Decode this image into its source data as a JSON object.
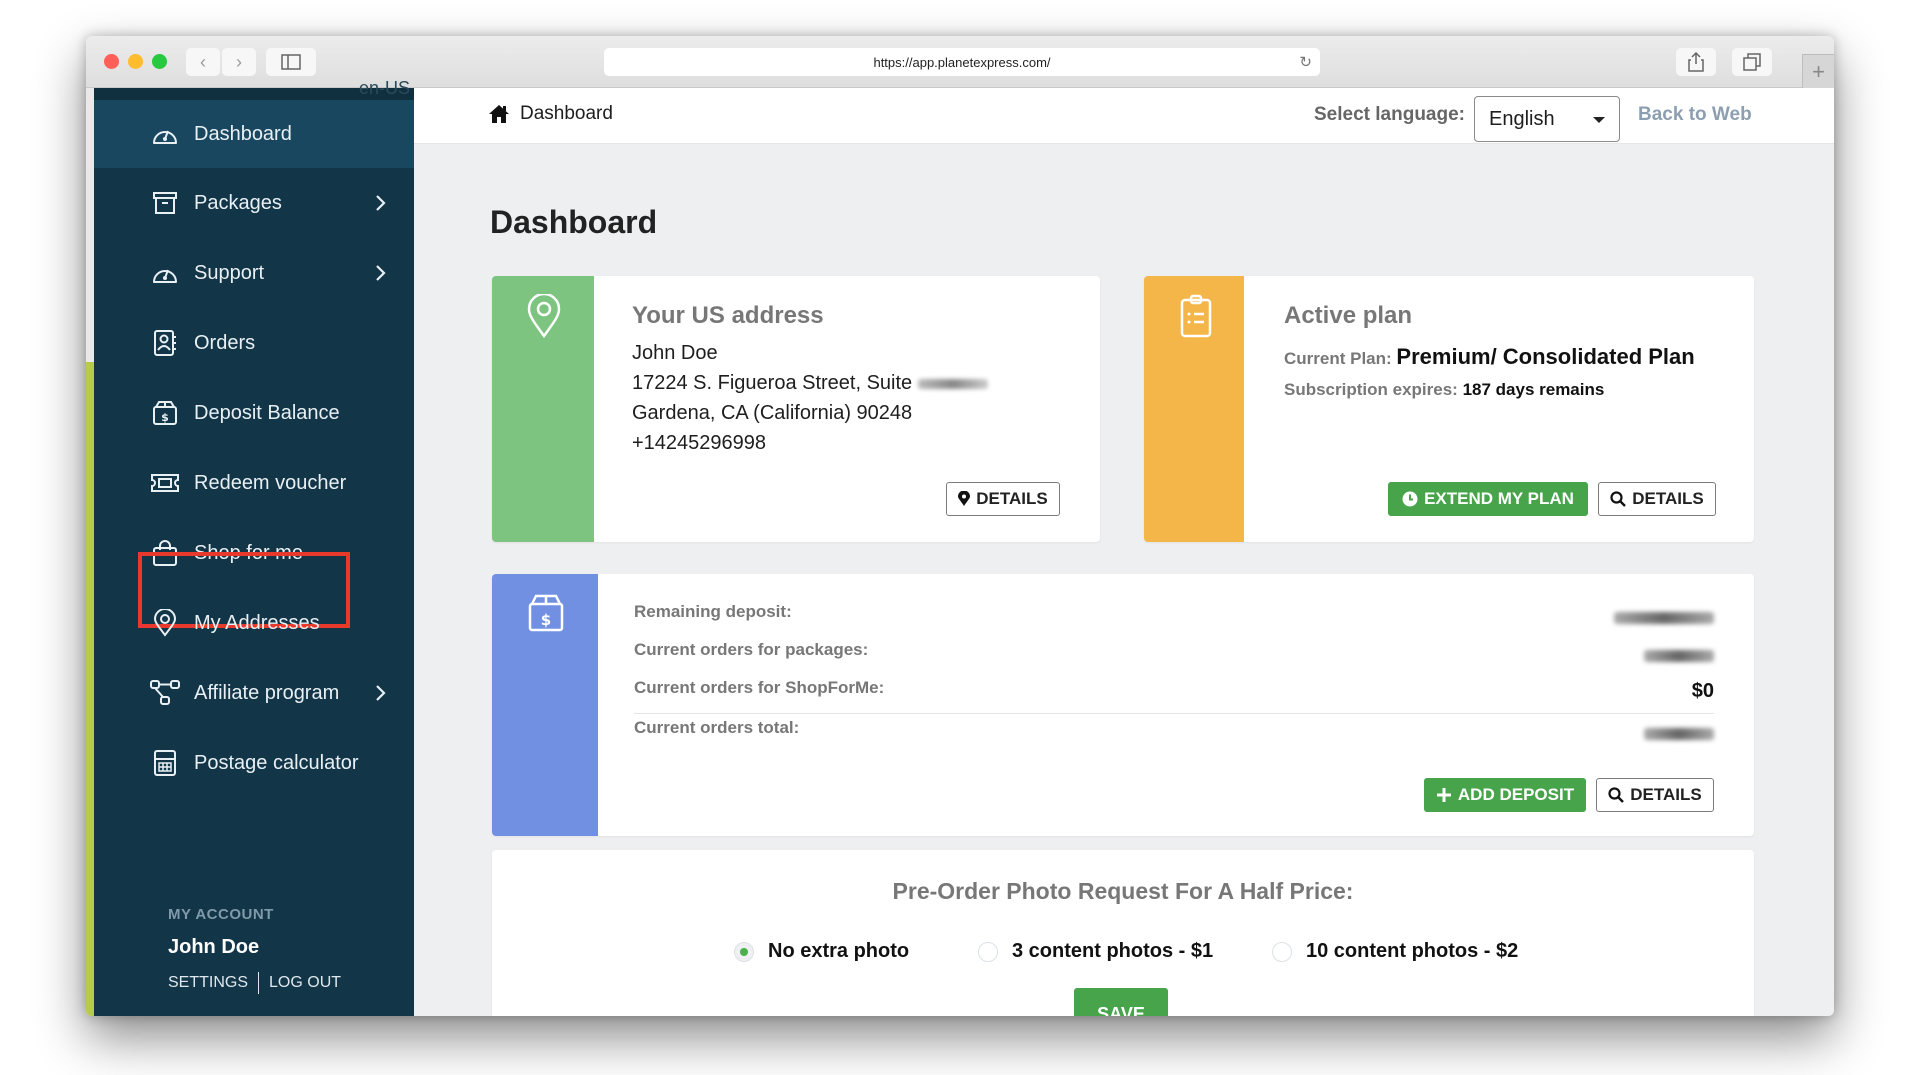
{
  "browser": {
    "url": "https://app.planetexpress.com/",
    "new_tab_symbol": "+"
  },
  "sidebar": {
    "locale_hint": "en-US",
    "items": [
      {
        "label": "Dashboard",
        "icon": "dashboard-gauge-icon",
        "active": true,
        "has_chevron": false
      },
      {
        "label": "Packages",
        "icon": "archive-box-icon",
        "active": false,
        "has_chevron": true
      },
      {
        "label": "Support",
        "icon": "gauge-icon",
        "active": false,
        "has_chevron": true
      },
      {
        "label": "Orders",
        "icon": "contact-book-icon",
        "active": false,
        "has_chevron": false
      },
      {
        "label": "Deposit Balance",
        "icon": "dollar-box-icon",
        "active": false,
        "has_chevron": false
      },
      {
        "label": "Redeem voucher",
        "icon": "ticket-icon",
        "active": false,
        "has_chevron": false
      },
      {
        "label": "Shop for me",
        "icon": "shopping-bag-icon",
        "active": false,
        "has_chevron": false,
        "highlighted": true
      },
      {
        "label": "My Addresses",
        "icon": "map-pin-icon",
        "active": false,
        "has_chevron": false
      },
      {
        "label": "Affiliate program",
        "icon": "network-icon",
        "active": false,
        "has_chevron": true
      },
      {
        "label": "Postage calculator",
        "icon": "calculator-icon",
        "active": false,
        "has_chevron": false
      }
    ],
    "account": {
      "section_title": "MY ACCOUNT",
      "name": "John Doe",
      "settings_label": "SETTINGS",
      "logout_label": "LOG OUT"
    }
  },
  "topbar": {
    "breadcrumb": "Dashboard",
    "language_label": "Select language:",
    "language_value": "English",
    "back_to_web": "Back to Web"
  },
  "page_title": "Dashboard",
  "address_card": {
    "title": "Your US address",
    "name": "John Doe",
    "street": "17224 S. Figueroa Street, Suite",
    "city": "Gardena, CA (California) 90248",
    "phone": "+14245296998",
    "details_button": "DETAILS",
    "color": "#7cc47f"
  },
  "plan_card": {
    "title": "Active plan",
    "current_plan_label": "Current Plan:",
    "current_plan_value": "Premium/ Consolidated Plan",
    "expires_label": "Subscription expires:",
    "expires_value": "187 days remains",
    "extend_button": "EXTEND MY PLAN",
    "details_button": "DETAILS",
    "color": "#f4b549"
  },
  "deposit_card": {
    "rows": [
      {
        "label": "Remaining deposit:",
        "value": null,
        "blurred": true
      },
      {
        "label": "Current orders for packages:",
        "value": null,
        "blurred": true
      },
      {
        "label": "Current orders for ShopForMe:",
        "value": "$0",
        "blurred": false
      },
      {
        "label": "Current orders total:",
        "value": null,
        "blurred": true
      }
    ],
    "add_deposit_button": "ADD DEPOSIT",
    "details_button": "DETAILS",
    "color": "#7190e2"
  },
  "photo_request": {
    "title": "Pre-Order Photo Request For A Half Price:",
    "options": [
      {
        "label": "No extra photo",
        "checked": true
      },
      {
        "label": "3 content photos - $1",
        "checked": false
      },
      {
        "label": "10 content photos - $2",
        "checked": false
      }
    ],
    "save_button": "SAVE"
  },
  "colors": {
    "sidebar_bg": "#133548",
    "sidebar_active": "#1a4760",
    "green_button": "#47a44b",
    "highlight_red": "#e8392c"
  }
}
